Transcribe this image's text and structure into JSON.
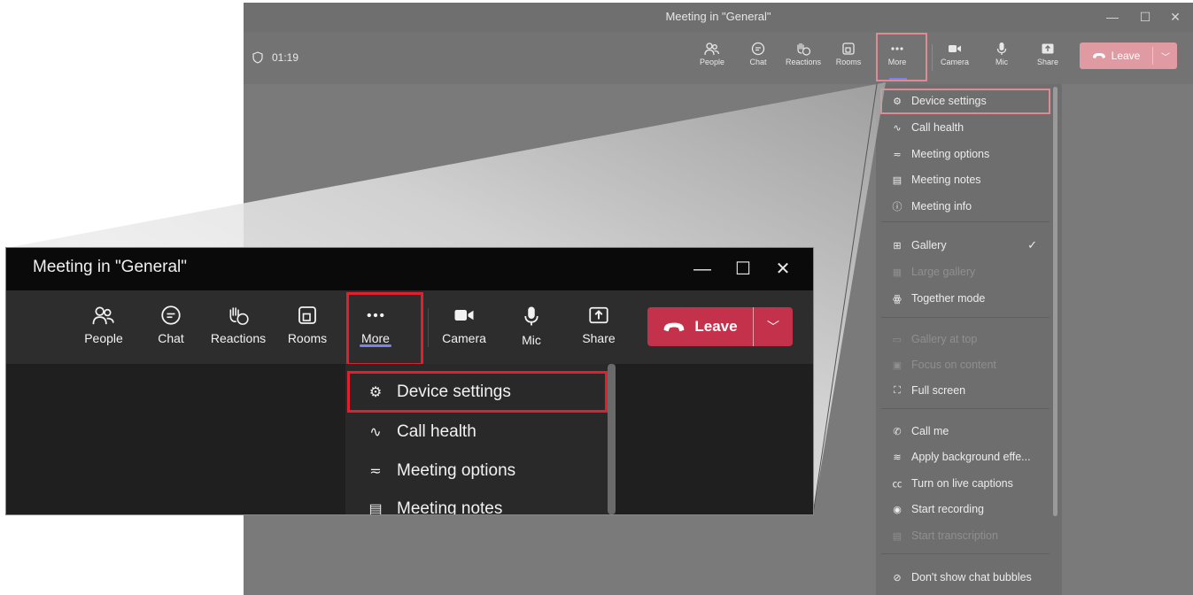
{
  "window": {
    "title": "Meeting in \"General\"",
    "minimize": "—",
    "maximize": "☐",
    "close": "✕"
  },
  "meeting": {
    "timer": "01:19"
  },
  "toolbar": {
    "people": "People",
    "chat": "Chat",
    "reactions": "Reactions",
    "rooms": "Rooms",
    "more": "More",
    "camera": "Camera",
    "mic": "Mic",
    "share": "Share",
    "leave": "Leave",
    "leave_options": "﹀"
  },
  "menu": {
    "device_settings": "Device settings",
    "call_health": "Call health",
    "meeting_options": "Meeting options",
    "meeting_notes": "Meeting notes",
    "meeting_info": "Meeting info",
    "gallery": "Gallery",
    "large_gallery": "Large gallery",
    "together_mode": "Together mode",
    "gallery_at_top": "Gallery at top",
    "focus_on_content": "Focus on content",
    "full_screen": "Full screen",
    "call_me": "Call me",
    "apply_background": "Apply background effe...",
    "live_captions": "Turn on live captions",
    "start_recording": "Start recording",
    "start_transcription": "Start transcription",
    "dont_show_chat_bubbles": "Don't show chat bubbles",
    "check_mark": "✓"
  },
  "colors": {
    "leave": "#c4314b",
    "highlight": "#e0202f",
    "accent": "#7b83eb"
  }
}
